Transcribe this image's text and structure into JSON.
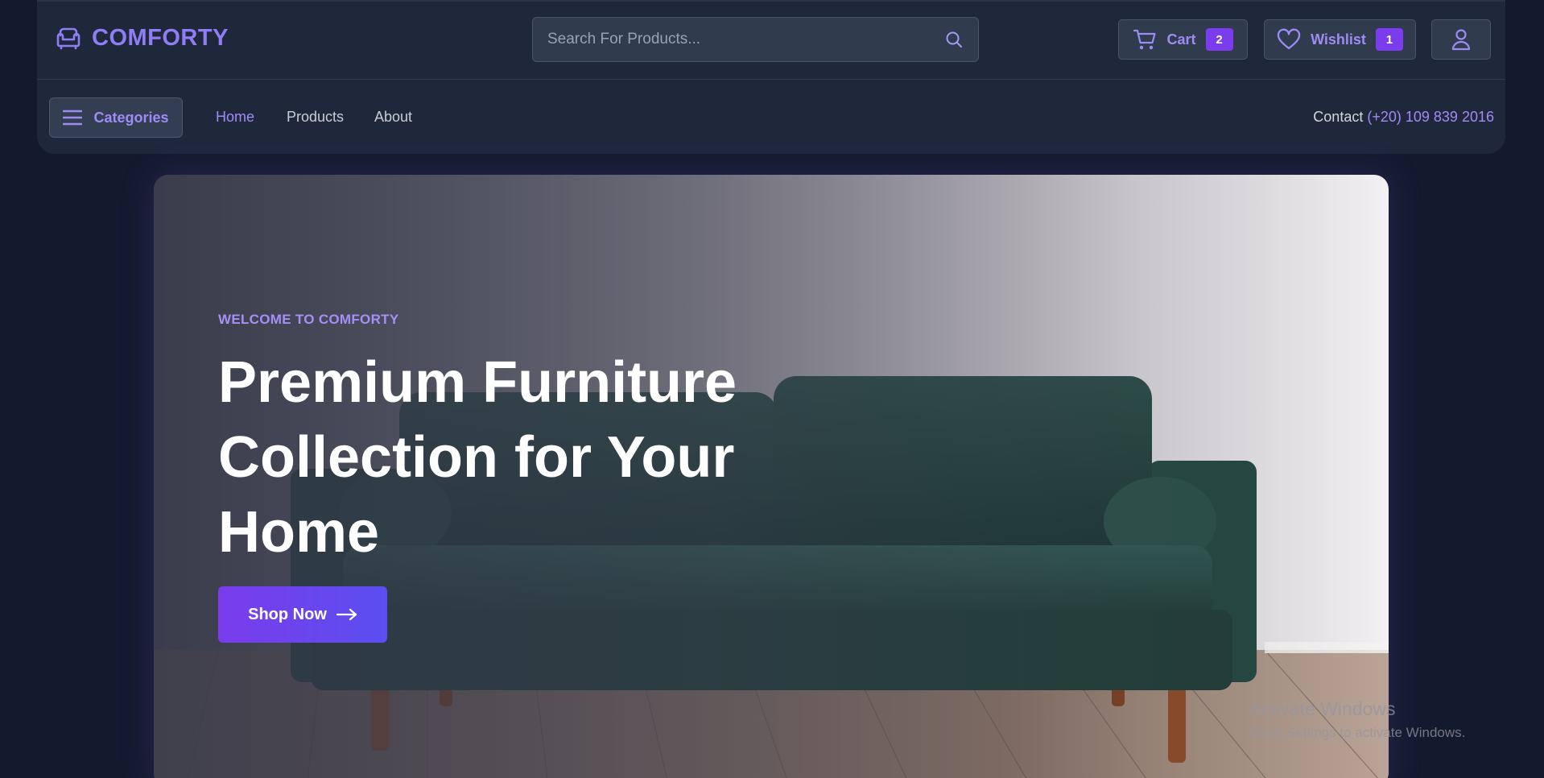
{
  "brand": {
    "name": "COMFORTY",
    "icon": "sofa-icon",
    "color": "#8f7df5"
  },
  "search": {
    "placeholder": "Search For Products...",
    "value": "",
    "icon": "search-icon"
  },
  "header_actions": {
    "cart": {
      "label": "Cart",
      "count": "2",
      "icon": "cart-icon"
    },
    "wishlist": {
      "label": "Wishlist",
      "count": "1",
      "icon": "heart-icon"
    },
    "account": {
      "icon": "user-icon"
    }
  },
  "nav": {
    "categories_label": "Categories",
    "categories_icon": "menu-icon",
    "links": [
      {
        "label": "Home",
        "active": true
      },
      {
        "label": "Products",
        "active": false
      },
      {
        "label": "About",
        "active": false
      }
    ],
    "contact_label": "Contact",
    "contact_phone": "(+20) 109 839 2016"
  },
  "hero": {
    "kicker": "WELCOME TO COMFORTY",
    "title": "Premium Furniture Collection for Your Home",
    "cta_label": "Shop Now",
    "cta_icon": "arrow-right-icon",
    "image": "green-velvet-sofa-photo"
  },
  "watermark": {
    "title": "Activate Windows",
    "subtitle": "Go to Settings to activate Windows."
  },
  "colors": {
    "accent": "#8f7df5",
    "badge": "#7a3cec",
    "page_bg": "#141a2e",
    "header_bg": "#1f283b"
  }
}
